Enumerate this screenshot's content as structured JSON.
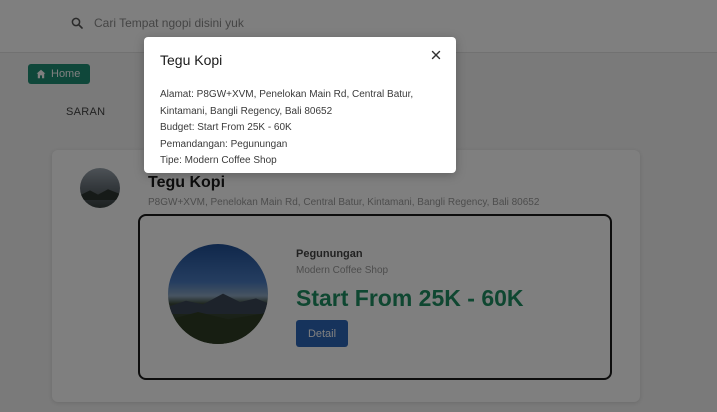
{
  "header": {
    "search_placeholder": "Cari Tempat ngopi disini yuk"
  },
  "nav": {
    "home_label": "Home"
  },
  "section": {
    "label": "SARAN"
  },
  "card": {
    "name": "Tegu Kopi",
    "address": "P8GW+XVM, Penelokan Main Rd, Central Batur, Kintamani, Bangli Regency, Bali 80652",
    "view": "Pegunungan",
    "type": "Modern Coffee Shop",
    "budget": "Start From 25K - 60K",
    "detail_label": "Detail"
  },
  "modal": {
    "title": "Tegu Kopi",
    "lines": [
      "Alamat: P8GW+XVM, Penelokan Main Rd, Central Batur,",
      "Kintamani, Bangli Regency, Bali 80652",
      "Budget: Start From 25K - 60K",
      "Pemandangan: Pegunungan",
      "Tipe: Modern Coffee Shop"
    ]
  },
  "icons": {
    "search": "search-icon",
    "home": "home-icon",
    "close": "close-icon"
  },
  "colors": {
    "accent_green": "#1e8f74",
    "budget_green": "#1e8f62",
    "detail_blue": "#2c66b8"
  }
}
